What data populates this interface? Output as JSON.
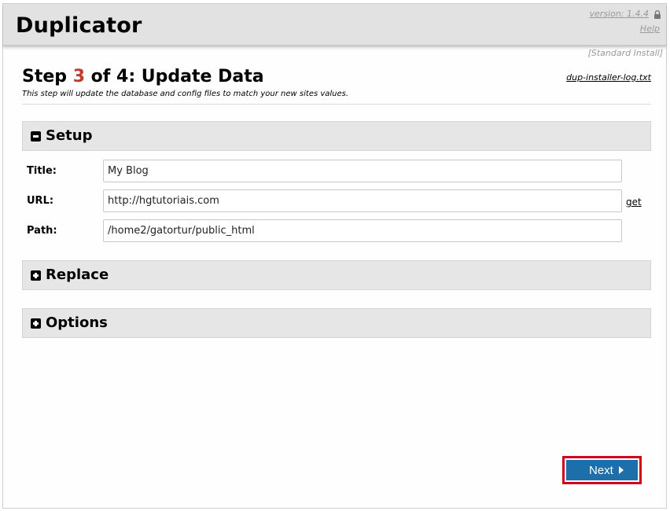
{
  "header": {
    "app_title": "Duplicator",
    "version_link": "version: 1.4.4",
    "help_link": "Help",
    "install_mode": "[Standard Install]",
    "lock_icon": "lock-icon"
  },
  "step": {
    "prefix": "Step ",
    "current": "3",
    "suffix": " of 4: Update Data",
    "description": "This step will update the database and config files to match your new sites values.",
    "log_link": "dup-installer-log.txt"
  },
  "sections": {
    "setup": {
      "label": "Setup",
      "state": "expanded",
      "icon": "minus-square-icon"
    },
    "replace": {
      "label": "Replace",
      "state": "collapsed",
      "icon": "plus-square-icon"
    },
    "options": {
      "label": "Options",
      "state": "collapsed",
      "icon": "plus-square-icon"
    }
  },
  "fields": {
    "title": {
      "label": "Title:",
      "value": "My Blog"
    },
    "url": {
      "label": "URL:",
      "value": "http://hgtutoriais.com",
      "get_link": "get"
    },
    "path": {
      "label": "Path:",
      "value": "/home2/gatortur/public_html"
    }
  },
  "actions": {
    "next_label": "Next",
    "next_icon": "caret-right-icon"
  },
  "colors": {
    "accent_step": "#c23c2c",
    "next_button": "#1c6fa8",
    "highlight_outline": "#d0021b",
    "section_bg": "#e6e6e6",
    "header_bg": "#e2e2e2"
  }
}
